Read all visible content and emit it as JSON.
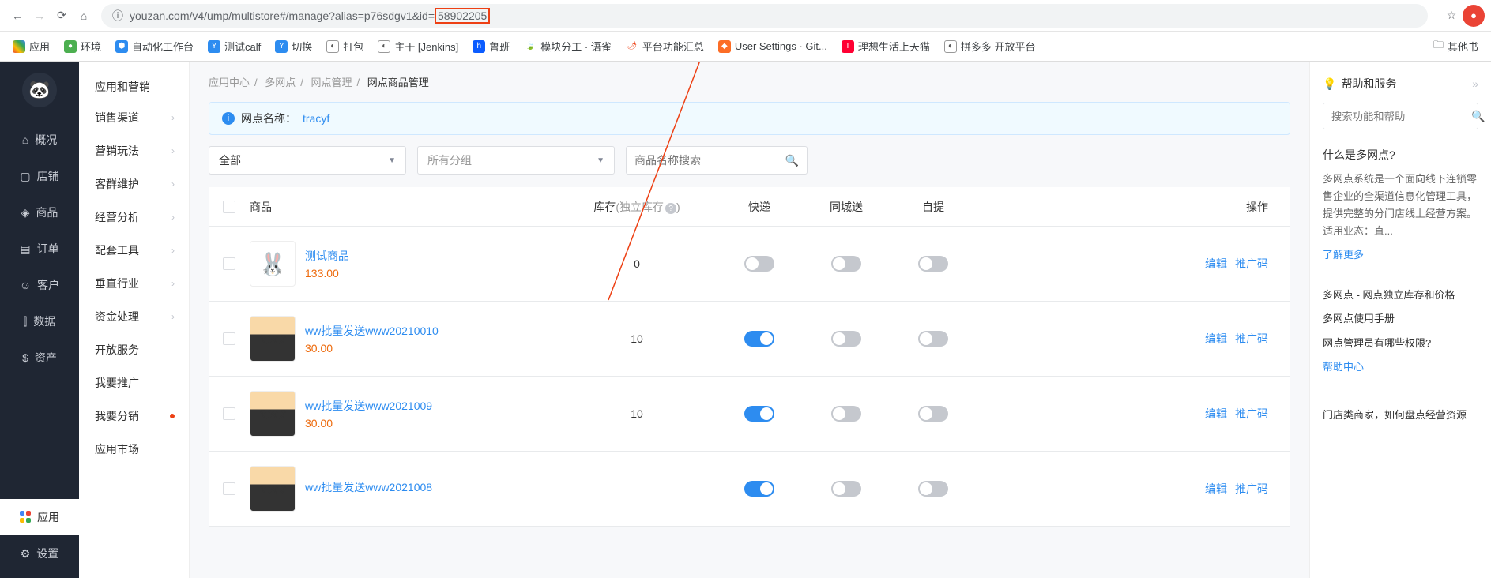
{
  "url": {
    "prefix": "youzan.com/v4/ump/multistore#/manage?alias=p76sdgv1&id=",
    "highlight": "58902205"
  },
  "bookmarks": [
    {
      "label": "应用",
      "color": "#ea4335"
    },
    {
      "label": "环境",
      "color": "#4caf50"
    },
    {
      "label": "自动化工作台",
      "color": "#2d8cf0"
    },
    {
      "label": "测试calf",
      "color": "#2d8cf0"
    },
    {
      "label": "切换",
      "color": "#2d8cf0"
    },
    {
      "label": "打包",
      "color": "#555"
    },
    {
      "label": "主干 [Jenkins]",
      "color": "#555"
    },
    {
      "label": "鲁班",
      "color": "#0b5cff"
    },
    {
      "label": "模块分工 · 语雀",
      "color": "#31cc79"
    },
    {
      "label": "平台功能汇总",
      "color": "#ed4014"
    },
    {
      "label": "User Settings · Git...",
      "color": "#fc6d26"
    },
    {
      "label": "理想生活上天猫",
      "color": "#ff0033"
    },
    {
      "label": "拼多多 开放平台",
      "color": "#555"
    }
  ],
  "bookmarks_other": "其他书",
  "rail": [
    {
      "icon": "⌂",
      "label": "概况"
    },
    {
      "icon": "▢",
      "label": "店铺"
    },
    {
      "icon": "◈",
      "label": "商品"
    },
    {
      "icon": "▤",
      "label": "订单"
    },
    {
      "icon": "☺",
      "label": "客户"
    },
    {
      "icon": "⫿",
      "label": "数据"
    },
    {
      "icon": "$",
      "label": "资产"
    }
  ],
  "rail_app": "应用",
  "rail_setting": "设置",
  "submenu": {
    "title": "应用和营销",
    "items": [
      {
        "label": "销售渠道",
        "chev": true
      },
      {
        "label": "营销玩法",
        "chev": true
      },
      {
        "label": "客群维护",
        "chev": true
      },
      {
        "label": "经营分析",
        "chev": true
      },
      {
        "label": "配套工具",
        "chev": true
      },
      {
        "label": "垂直行业",
        "chev": true
      },
      {
        "label": "资金处理",
        "chev": true
      },
      {
        "label": "开放服务",
        "chev": false
      },
      {
        "label": "我要推广",
        "chev": false
      },
      {
        "label": "我要分销",
        "chev": false,
        "dot": true
      },
      {
        "label": "应用市场",
        "chev": false
      }
    ]
  },
  "crumb": [
    "应用中心",
    "多网点",
    "网点管理",
    "网点商品管理"
  ],
  "info": {
    "prefix": "网点名称：",
    "link": "tracyf"
  },
  "filters": {
    "all": "全部",
    "group": "所有分组",
    "search_ph": "商品名称搜索"
  },
  "thead": {
    "product": "商品",
    "stock": "库存",
    "stock_sub": "(独立库存",
    "express": "快递",
    "city": "同城送",
    "pickup": "自提",
    "ops": "操作"
  },
  "rows": [
    {
      "img": "🐰",
      "title": "测试商品",
      "price": "133.00",
      "stock": "0",
      "t": [
        false,
        false,
        false
      ]
    },
    {
      "img": "man",
      "title": "ww批量发送www20210010",
      "price": "30.00",
      "stock": "10",
      "t": [
        true,
        false,
        false
      ]
    },
    {
      "img": "man",
      "title": "ww批量发送www2021009",
      "price": "30.00",
      "stock": "10",
      "t": [
        true,
        false,
        false
      ]
    },
    {
      "img": "man",
      "title": "ww批量发送www2021008",
      "price": "",
      "stock": "",
      "t": [
        true,
        false,
        false
      ]
    }
  ],
  "ops": {
    "edit": "编辑",
    "promo": "推广码"
  },
  "help": {
    "title": "帮助和服务",
    "search_ph": "搜索功能和帮助",
    "q": "什么是多网点?",
    "desc": "多网点系统是一个面向线下连锁零售企业的全渠道信息化管理工具，提供完整的分门店线上经营方案。适用业态：直...",
    "more": "了解更多",
    "links": [
      "多网点 - 网点独立库存和价格",
      "多网点使用手册",
      "网点管理员有哪些权限?",
      "帮助中心"
    ],
    "footer": "门店类商家，如何盘点经营资源"
  }
}
